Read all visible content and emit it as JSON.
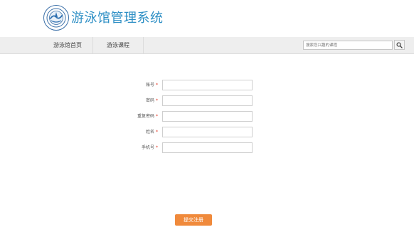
{
  "header": {
    "title": "游泳馆管理系统",
    "logo_icon": "swimming-logo-icon"
  },
  "nav": {
    "items": [
      {
        "label": "游泳馆首页"
      },
      {
        "label": "游泳课程"
      }
    ],
    "search_placeholder": "搜索您兴趣的课程",
    "search_icon": "search-icon"
  },
  "form": {
    "fields": [
      {
        "label": "账号",
        "required_mark": "*",
        "value": ""
      },
      {
        "label": "密码",
        "required_mark": "*",
        "value": ""
      },
      {
        "label": "重复密码",
        "required_mark": "*",
        "value": ""
      },
      {
        "label": "姓名",
        "required_mark": "*",
        "value": ""
      },
      {
        "label": "手机号",
        "required_mark": "*",
        "value": ""
      }
    ],
    "submit_label": "提交注册"
  },
  "colors": {
    "brand": "#2e8fc5",
    "accent": "#f08a3c",
    "required": "#e0301e"
  }
}
